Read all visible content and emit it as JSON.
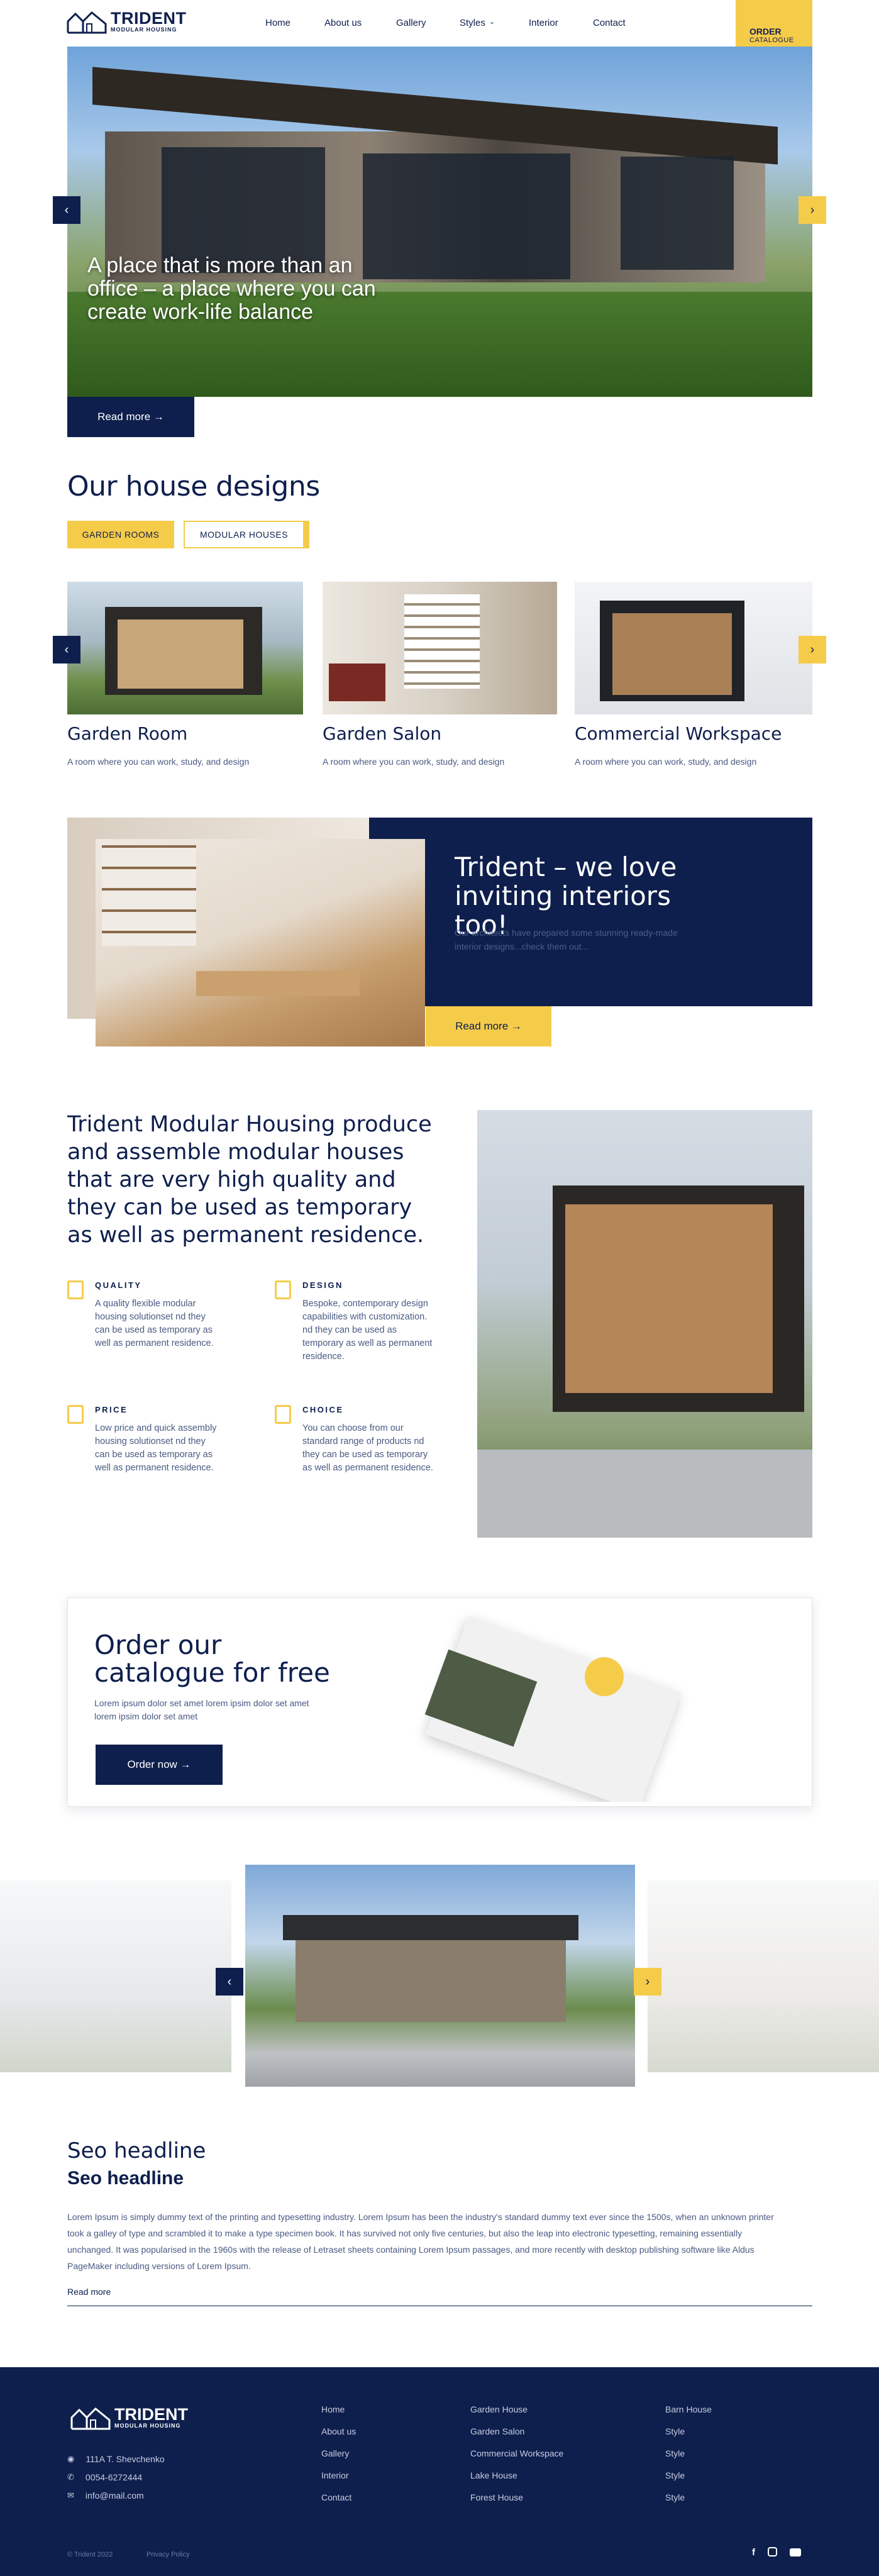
{
  "header": {
    "brand": "TRIDENT",
    "brand_sub": "MODULAR HOUSING",
    "nav": [
      "Home",
      "About us",
      "Gallery",
      "Styles",
      "Interior",
      "Contact"
    ],
    "order_title": "ORDER",
    "order_sub": "CATALOGUE"
  },
  "hero": {
    "headline": "A place that is more than an office – a place where you can create work-life balance",
    "read_more": "Read more →"
  },
  "designs": {
    "title": "Our house designs",
    "tabs": [
      "GARDEN ROOMS",
      "MODULAR HOUSES"
    ],
    "cards": [
      {
        "title": "Garden Room",
        "subtitle": "A room where you can work, study, and design"
      },
      {
        "title": "Garden Salon",
        "subtitle": "A room where you can work, study, and design"
      },
      {
        "title": "Commercial Workspace",
        "subtitle": "A room where you can work, study, and design"
      }
    ]
  },
  "interiors": {
    "title": "Trident – we love inviting interiors too!",
    "text": "Our architects have prepared some stunning ready-made interior designs...check them out...",
    "button": "Read more →"
  },
  "about": {
    "text": "Trident Modular Housing produce and assemble modular houses that are very high quality and they can be used as temporary as well as permanent residence.",
    "features": [
      {
        "title": "QUALITY",
        "text": "A quality flexible modular housing solutionset nd they can be used as temporary as well as permanent residence."
      },
      {
        "title": "DESIGN",
        "text": "Bespoke, contemporary design capabilities with customization. nd they can be used as temporary as well as permanent residence."
      },
      {
        "title": "PRICE",
        "text": "Low price and quick assembly housing solutionset nd they can be used as temporary as well as permanent residence."
      },
      {
        "title": "CHOICE",
        "text": "You can choose from our standard range of products nd they can be used as temporary as well as permanent residence."
      }
    ]
  },
  "catalogue": {
    "title": "Order our catalogue for free",
    "text": "Lorem ipsum dolor set amet lorem ipsim dolor set amet lorem ipsim dolor set amet",
    "button": "Order now →"
  },
  "seo": {
    "headline1": "Seo headline",
    "headline2": "Seo headline",
    "text": "Lorem Ipsum is simply dummy text of the printing and typesetting industry. Lorem Ipsum has been the industry's standard dummy text ever since the 1500s, when an unknown printer took a galley of type and scrambled it to make a type specimen book. It has survived not only five centuries, but also the leap into electronic typesetting, remaining essentially unchanged. It was popularised in the 1960s with the release of Letraset sheets containing Lorem Ipsum passages, and more recently with desktop publishing software like Aldus PageMaker including versions of Lorem Ipsum.",
    "read_more": "Read more"
  },
  "footer": {
    "address": "111A T. Shevchenko",
    "phone": "0054-6272444",
    "email": "info@mail.com",
    "col1": [
      "Home",
      "About us",
      "Gallery",
      "Interior",
      "Contact"
    ],
    "col2": [
      "Garden House",
      "Garden Salon",
      "Commercial Workspace",
      "Lake House",
      "Forest House"
    ],
    "col3": [
      "Barn House",
      "Style",
      "Style",
      "Style",
      "Style"
    ],
    "copyright": "© Trident 2022",
    "privacy": "Privacy Policy"
  },
  "colors": {
    "navy": "#0e1f4d",
    "yellow": "#f5cb4a"
  }
}
